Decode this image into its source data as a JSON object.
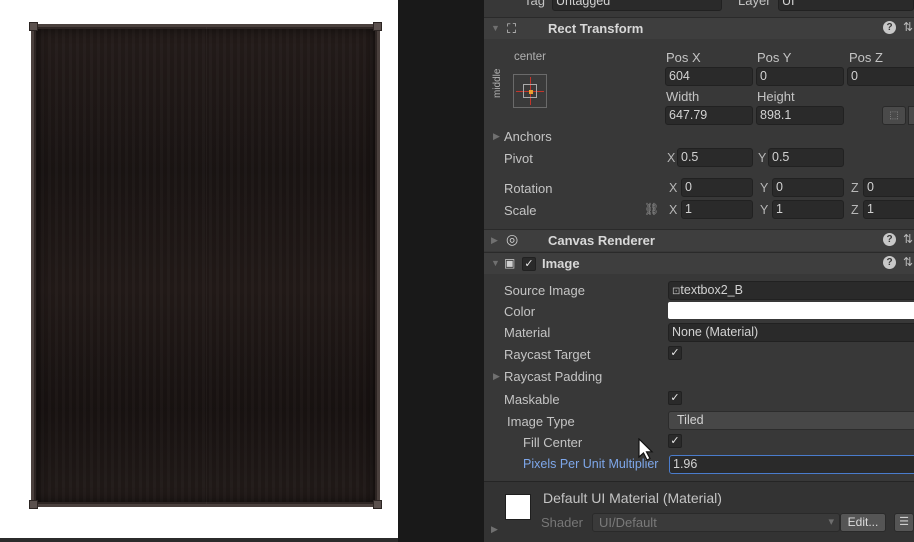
{
  "top_strip": {
    "tag_label": "Tag",
    "tag_value": "Untagged",
    "layer_label": "Layer",
    "layer_value": "UI"
  },
  "rect_transform": {
    "title": "Rect Transform",
    "anchor_h": "center",
    "anchor_v": "middle",
    "pos_x_label": "Pos X",
    "pos_y_label": "Pos Y",
    "pos_z_label": "Pos Z",
    "pos_x": "604",
    "pos_y": "0",
    "pos_z": "0",
    "width_label": "Width",
    "height_label": "Height",
    "width": "647.79",
    "height": "898.1",
    "anchors_label": "Anchors",
    "pivot_label": "Pivot",
    "pivot_x": "0.5",
    "pivot_y": "0.5",
    "rotation_label": "Rotation",
    "rot_x": "0",
    "rot_y": "0",
    "rot_z": "0",
    "scale_label": "Scale",
    "scale_x": "1",
    "scale_y": "1",
    "scale_z": "1",
    "axis_x": "X",
    "axis_y": "Y",
    "axis_z": "Z"
  },
  "canvas_renderer": {
    "title": "Canvas Renderer"
  },
  "image": {
    "title": "Image",
    "source_image_label": "Source Image",
    "source_image_value": "textbox2_B",
    "color_label": "Color",
    "color_value": "#ffffff",
    "material_label": "Material",
    "material_value": "None (Material)",
    "raycast_target_label": "Raycast Target",
    "raycast_padding_label": "Raycast Padding",
    "maskable_label": "Maskable",
    "image_type_label": "Image Type",
    "image_type_value": "Tiled",
    "fill_center_label": "Fill Center",
    "ppu_label": "Pixels Per Unit Multiplier",
    "ppu_value": "1.96"
  },
  "material_footer": {
    "name": "Default UI Material (Material)",
    "shader_label": "Shader",
    "shader_value": "UI/Default",
    "edit_button": "Edit..."
  },
  "icons": {
    "help": "?",
    "presets": "⇅",
    "check": "✓",
    "fold_open": "▼",
    "fold_closed": "▶",
    "chevron": "▾",
    "list": "☰"
  }
}
